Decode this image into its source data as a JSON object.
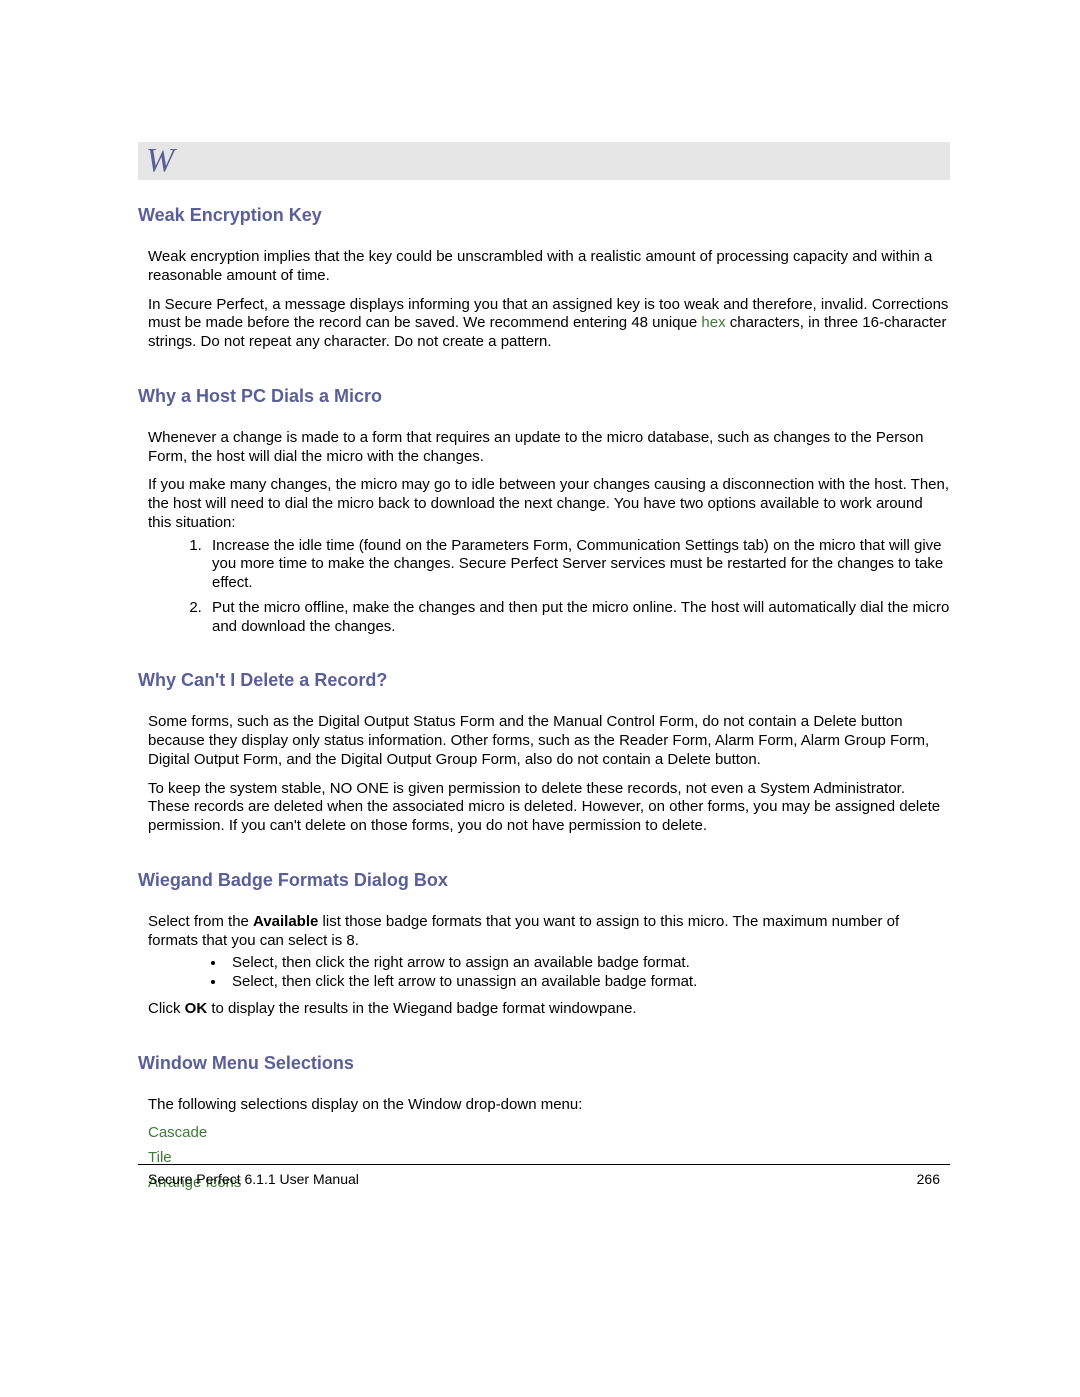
{
  "index_letter": "W",
  "sections": {
    "weak": {
      "heading": "Weak Encryption Key",
      "p1": "Weak encryption implies that the key could be unscrambled with a realistic amount of processing capacity and within a reasonable amount of time.",
      "p2a": "In Secure Perfect, a message displays informing you that an assigned key is too weak and therefore, invalid. Corrections must be made before the record can be saved. We recommend entering 48 unique ",
      "p2_link": "hex",
      "p2b": " characters, in three 16-character strings. Do not repeat any character. Do not create a pattern."
    },
    "host": {
      "heading": "Why a Host PC Dials a Micro",
      "p1": "Whenever a change is made to a form that requires an update to the micro database, such as changes to the Person Form, the host will dial the micro with the changes.",
      "p2": "If you make many changes, the micro may go to idle between your changes causing a disconnection with the host. Then, the host will need to dial the micro back to download the next change. You have two options available to work around this situation:",
      "li1": "Increase the idle time (found on the Parameters Form, Communication Settings tab) on the micro that will give you more time to make the changes. Secure Perfect Server services must be restarted for the changes to take effect.",
      "li2": "Put the micro offline, make the changes and then put the micro online. The host will automatically dial the micro and download the changes."
    },
    "delete": {
      "heading": "Why Can't I Delete a Record?",
      "p1": "Some forms, such as the Digital Output Status Form and the Manual Control Form, do not contain a Delete button because they display only status information. Other forms, such as the Reader Form, Alarm Form, Alarm Group Form, Digital Output Form, and the Digital Output Group Form, also do not contain a Delete button.",
      "p2": "To keep the system stable, NO ONE is given permission to delete these records, not even a System Administrator. These records are deleted when the associated micro is deleted. However, on other forms, you may be assigned delete permission. If you can't delete on those forms, you do not have permission to delete."
    },
    "wiegand": {
      "heading": "Wiegand Badge Formats Dialog Box",
      "p1a": "Select from the ",
      "p1_bold": "Available",
      "p1b": " list those badge formats that you want to assign to this micro. The maximum number of formats that you can select is 8.",
      "li1": "Select, then click the right arrow to assign an available badge format.",
      "li2": "Select, then click the left arrow to unassign an available badge format.",
      "p2a": "Click ",
      "p2_bold": "OK",
      "p2b": " to display the results in the Wiegand badge format windowpane."
    },
    "window_menu": {
      "heading": "Window Menu Selections",
      "p1": "The following selections display on the Window drop-down menu:",
      "links": {
        "cascade": "Cascade",
        "tile": "Tile",
        "arrange": "Arrange Icons"
      }
    }
  },
  "footer": {
    "left": "Secure Perfect 6.1.1 User Manual",
    "right": "266"
  }
}
